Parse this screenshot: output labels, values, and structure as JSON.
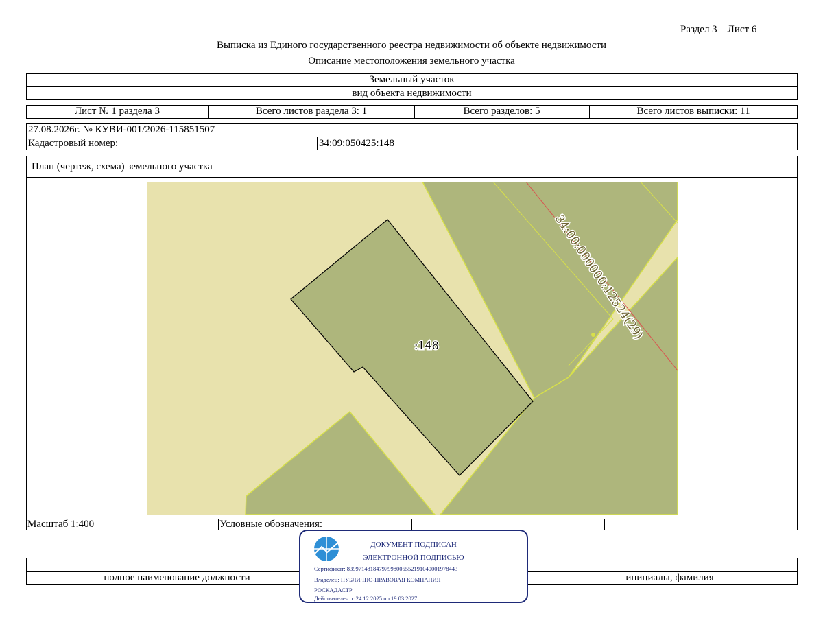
{
  "header": {
    "section_sheet": "Раздел 3    Лист 6",
    "title": "Выписка из Единого государственного реестра недвижимости об объекте недвижимости",
    "subtitle": "Описание местоположения земельного участка"
  },
  "object": {
    "kind": "Земельный участок",
    "kind_caption": "вид объекта недвижимости"
  },
  "sheet_info": {
    "sheet": "Лист № 1 раздела 3",
    "total_section_sheets": "Всего листов раздела 3: 1",
    "total_sections": "Всего разделов: 5",
    "total_extract_sheets": "Всего листов выписки: 11"
  },
  "record": {
    "date_number": "27.08.2026г. № КУВИ-001/2026-115851507",
    "cadastral_label": "Кадастровый номер:",
    "cadastral_value": "34:09:050425:148"
  },
  "plan": {
    "heading": "План (чертеж, схема) земельного участка",
    "parcel_label": ":148",
    "neighbor_label": "34:00:000000:12524(29)",
    "colors": {
      "background": "#e8e2ad",
      "parcel_fill": "#aeb67c",
      "border_yellow": "#d7e04a",
      "red_line": "#d9534f"
    }
  },
  "footer": {
    "scale": "Масштаб 1:400",
    "legend_label": "Условные обозначения:",
    "position_caption": "полное наименование должности",
    "initials_caption": "инициалы, фамилия"
  },
  "stamp": {
    "line1": "ДОКУМЕНТ ПОДПИСАН",
    "line2": "ЭЛЕКТРОННОЙ ПОДПИСЬЮ",
    "certificate": "Сертификат: 83997148184797998005552191040001978443",
    "owner": "Владелец: ПУБЛИЧНО-ПРАВОВАЯ КОМПАНИЯ",
    "owner2": "РОСКАДАСТР",
    "validity": "Действителен: с 24.12.2025 по 19.03.2027",
    "color": "#1e2a78"
  }
}
